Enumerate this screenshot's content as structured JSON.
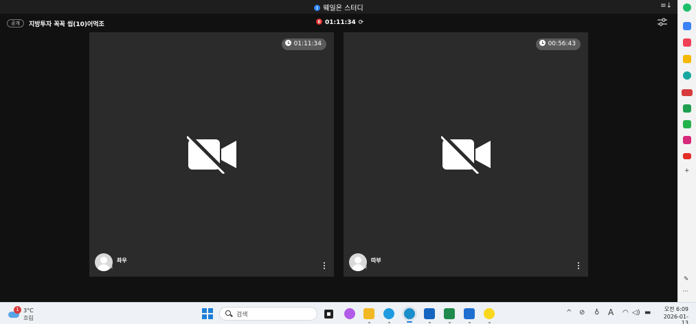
{
  "window": {
    "title": "웨일온 스터디",
    "menu_icon": "collapse-list-icon"
  },
  "room": {
    "visibility_badge": "공개",
    "name": "지방투자 꼭꼭 씹(10)어먹조",
    "session_timer": "01:11:34",
    "rec_icon": "pause-icon",
    "refresh_icon": "refresh-icon",
    "settings_icon": "sliders-icon"
  },
  "participants": [
    {
      "name": "좌우",
      "timer": "01:11:34",
      "camera": "off",
      "mic": "off"
    },
    {
      "name": "따부",
      "timer": "00:56:43",
      "camera": "off",
      "mic": "off"
    }
  ],
  "sidebar": {
    "icons": [
      "whale-icon",
      "calendar-icon",
      "pocket-icon",
      "star-icon",
      "edge-icon",
      "ad-badge-icon",
      "cart-icon",
      "chat-icon",
      "instagram-icon",
      "youtube-icon",
      "add-icon",
      "pin-icon",
      "more-icon"
    ],
    "add_label": "+",
    "more_label": "···"
  },
  "taskbar": {
    "weather_temp": "3°C",
    "weather_cond": "흐림",
    "weather_alert": "1",
    "search_placeholder": "검색",
    "clock_time": "오전 6:09",
    "clock_date": "2026-01-13",
    "tray_caret": "^",
    "ime_label": "A",
    "colors": {
      "accent": "#1d7fd8",
      "taskbar_bg": "#eef1f5"
    }
  }
}
